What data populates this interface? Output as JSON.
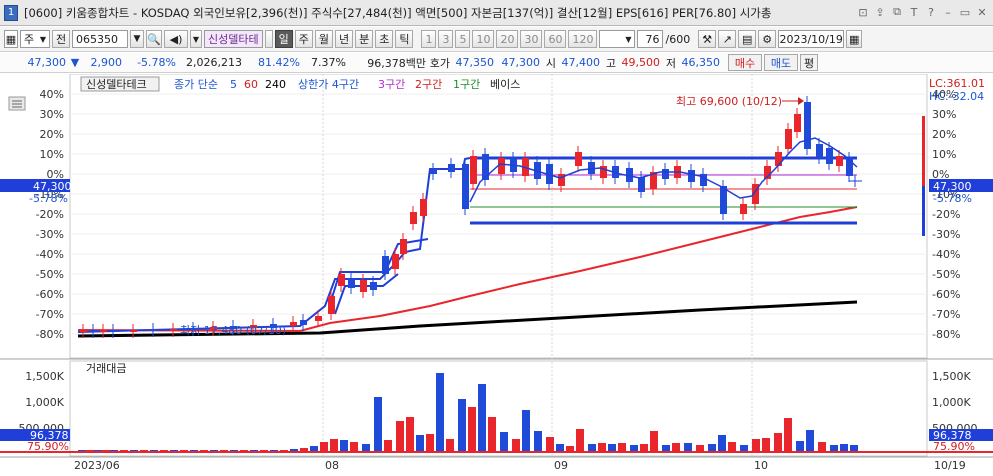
{
  "titlebar": {
    "window_number": "1",
    "title": "[0600] 키움종합차트 - KOSDAQ 외국인보유[2,396(천)] 주식수[27,484(천)] 액면[500] 자본금[137(억)] 결산[12월] EPS[616] PER[76.80] 시가총"
  },
  "toolbar": {
    "market": "주",
    "jeon": "전",
    "code": "065350",
    "stock_name": "신성델타테",
    "period_buttons": [
      "일",
      "주",
      "월",
      "년",
      "분",
      "초",
      "틱"
    ],
    "minute_buttons": [
      "1",
      "3",
      "5",
      "10",
      "20",
      "30",
      "60",
      "120"
    ],
    "count": "76",
    "count_total": "/600",
    "date": "2023/10/19"
  },
  "quote": {
    "price": "47,300",
    "arrow": "▼",
    "change": "2,900",
    "change_pct": "-5.78%",
    "volume": "2,026,213",
    "ratio1": "81.42%",
    "ratio2": "7.37%",
    "trade_amount": "96,378백만",
    "hoga_label": "호가",
    "hoga": "47,350",
    "hoga2": "47,300",
    "open_label": "시",
    "open": "47,400",
    "high_label": "고",
    "high": "49,500",
    "low_label": "저",
    "low": "46,350",
    "sell_btn": "매수",
    "buy_btn": "매도",
    "avg_btn": "평"
  },
  "price_legend": {
    "name": "신성델타테크",
    "close_label": "종가 단순",
    "ma5": "5",
    "ma60": "60",
    "ma240": "240",
    "upper_label": "상한가 4구간",
    "gap3": "3구간",
    "gap2": "2구간",
    "gap1": "1구간",
    "base": "베이스"
  },
  "lc_hc": {
    "lc": "LC:361.01",
    "hc": "HC:-32.04"
  },
  "annotations": {
    "max": "최고 69,600 (10/12)",
    "min": "최저 17,480 (07/10)"
  },
  "price_badge": {
    "price": "47,300",
    "pct": "-5.78%"
  },
  "volume_panel": {
    "title": "거래대금",
    "current": "96,378",
    "pct": "75.90%",
    "ticks": [
      "1,500K",
      "1,000K",
      "500,000"
    ]
  },
  "axis": {
    "pct_ticks": [
      "40%",
      "30%",
      "20%",
      "10%",
      "0%",
      "-10%",
      "-20%",
      "-30%",
      "-40%",
      "-50%",
      "-60%",
      "-70%",
      "-80%"
    ],
    "dates": [
      "2023/06",
      "08",
      "09",
      "10",
      "10/19"
    ]
  },
  "colors": {
    "up": "#e8262b",
    "down": "#1f4bd8",
    "accent": "#3b6dbf"
  }
}
